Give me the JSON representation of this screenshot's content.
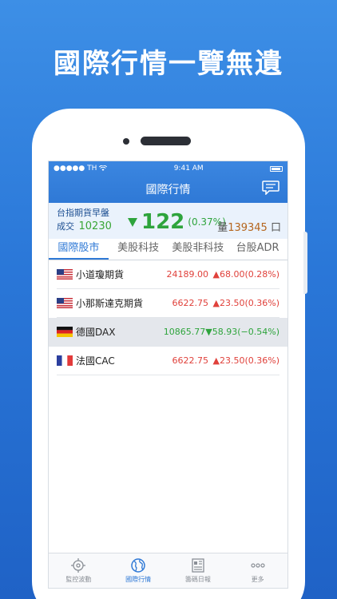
{
  "headline": "國際行情一覽無遺",
  "status": {
    "carrier": "●●●●● TH",
    "time": "9:41 AM"
  },
  "nav": {
    "title": "國際行情"
  },
  "futures": {
    "name": "台指期貨早盤",
    "deal_label": "成交",
    "deal_price": "10230",
    "change": "122",
    "change_pct": "(0.37%)",
    "volume_label": "量",
    "volume": "139345",
    "volume_unit": "口"
  },
  "tabs": [
    "國際股市",
    "美股科技",
    "美股非科技",
    "台股ADR"
  ],
  "rows": [
    {
      "flag": "us-flag",
      "name": "小道瓊期貨",
      "price": "24189.00",
      "change": "▲68.00(0.28%)",
      "dir": "up"
    },
    {
      "flag": "us-flag",
      "name": "小那斯達克期貨",
      "price": "6622.75",
      "change": "▲23.50(0.36%)",
      "dir": "up"
    },
    {
      "flag": "de-flag",
      "name": "德國DAX",
      "price": "10865.77",
      "change": "▼58.93(−0.54%)",
      "dir": "down"
    },
    {
      "flag": "fr-flag",
      "name": "法國CAC",
      "price": "6622.75",
      "change": "▲23.50(0.36%)",
      "dir": "up"
    }
  ],
  "tabbar": [
    "監控波動",
    "國際行情",
    "籌碼日報",
    "更多"
  ],
  "colors": {
    "accent": "#2f79d6",
    "up": "#e0413b",
    "down": "#2ea43c"
  }
}
